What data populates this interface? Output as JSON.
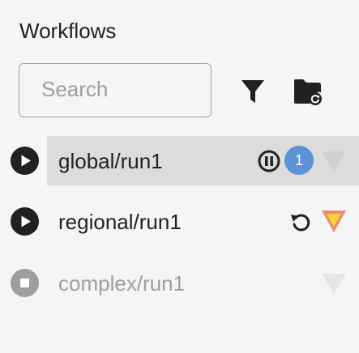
{
  "header": {
    "title": "Workflows"
  },
  "search": {
    "placeholder": "Search",
    "value": ""
  },
  "toolbar": {
    "filter_icon": "filter-icon",
    "folder_icon": "folder-refresh-icon"
  },
  "workflows": [
    {
      "name": "global/run1",
      "state": "running",
      "selected": true,
      "status_icon": "pause-circle-icon",
      "badge_count": "1",
      "state_indicator": "triangle-down-icon",
      "indicator_color": "#d0d0d0"
    },
    {
      "name": "regional/run1",
      "state": "running",
      "selected": false,
      "status_icon": "reload-icon",
      "state_indicator": "triangle-down-icon",
      "indicator_color_top": "#f08a6c",
      "indicator_color_bottom": "#f4d23c"
    },
    {
      "name": "complex/run1",
      "state": "stopped",
      "selected": false,
      "state_indicator": "triangle-down-icon",
      "indicator_color": "#e6e6e6"
    }
  ],
  "colors": {
    "background": "#f5f5f5",
    "selected_row": "#dcdcdc",
    "badge": "#5b93d6",
    "text": "#212121",
    "muted": "#9e9e9e"
  }
}
